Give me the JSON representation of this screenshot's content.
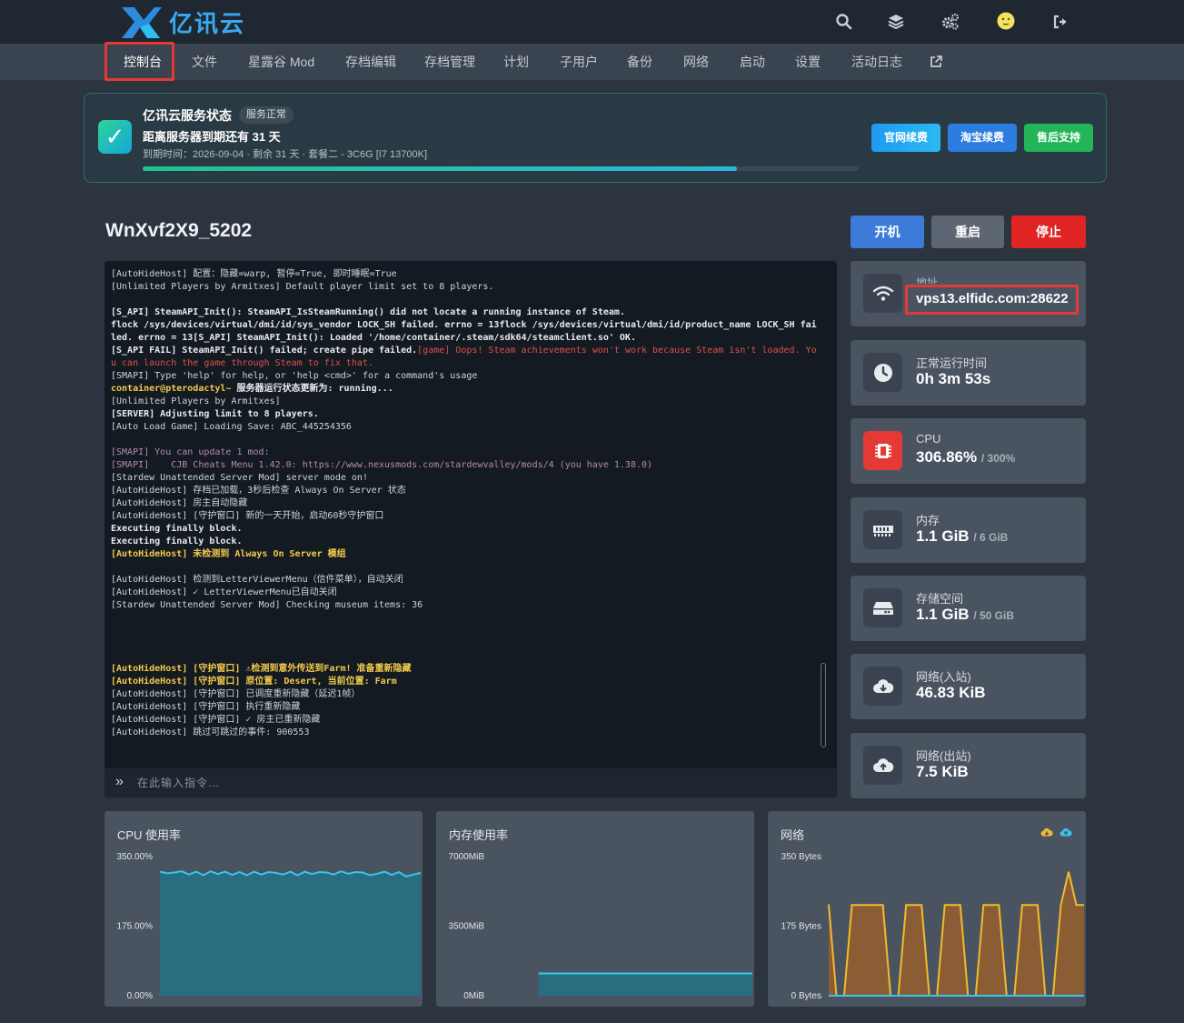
{
  "brand": {
    "name": "亿讯云"
  },
  "colors": {
    "accent": "#4fc3f7",
    "danger": "#e53935",
    "start": "#3d7bd9",
    "restart": "#5d6774",
    "chart_line": "#34c7e8",
    "chart_fill": "#2b6d80",
    "net_in": "#f3b92e",
    "net_fill": "#8a5d34"
  },
  "topbar": {
    "icons": [
      "search-icon",
      "layers-icon",
      "cogs-icon",
      "avatar",
      "logout-icon"
    ]
  },
  "nav": {
    "items": [
      {
        "label": "控制台",
        "active": true
      },
      {
        "label": "文件"
      },
      {
        "label": "星露谷 Mod"
      },
      {
        "label": "存档编辑"
      },
      {
        "label": "存档管理"
      },
      {
        "label": "计划"
      },
      {
        "label": "子用户"
      },
      {
        "label": "备份"
      },
      {
        "label": "网络"
      },
      {
        "label": "启动"
      },
      {
        "label": "设置"
      },
      {
        "label": "活动日志"
      }
    ],
    "external_icon": "external-link-icon"
  },
  "service": {
    "title": "亿讯云服务状态",
    "badge": "服务正常",
    "subtitle": "距离服务器到期还有 31 天",
    "meta": "到期时间：2026-09-04 · 剩余 31 天 · 套餐二 - 3C6G [I7 13700K]",
    "progress": 0.83,
    "buttons": {
      "official": "官网续费",
      "taobao": "淘宝续费",
      "support": "售后支持"
    }
  },
  "server": {
    "name": "WnXvf2X9_5202",
    "start_label": "开机",
    "restart_label": "重启",
    "stop_label": "停止"
  },
  "console": {
    "placeholder": "在此输入指令...",
    "prompt": "»",
    "lines": [
      {
        "text": "[AutoHideHost] 配置：隐藏=warp, 暂停=True, 即时睡眠=True",
        "style": ""
      },
      {
        "text": "[Unlimited Players by Armitxes] Default player limit set to 8 players.",
        "style": ""
      },
      {
        "text": "",
        "style": ""
      },
      {
        "text": "[S_API] SteamAPI_Init(): SteamAPI_IsSteamRunning() did not locate a running instance of Steam.",
        "style": "bold"
      },
      {
        "text": "flock /sys/devices/virtual/dmi/id/sys_vendor LOCK_SH failed. errno = 13flock /sys/devices/virtual/dmi/id/product_name LOCK_SH fai",
        "style": "bold"
      },
      {
        "text": "led. errno = 13[S_API] SteamAPI_Init(): Loaded '/home/container/.steam/sdk64/steamclient.so' OK.",
        "style": "bold"
      },
      {
        "text": "[S_API FAIL] SteamAPI_Init() failed; create pipe failed.",
        "style": "bold",
        "tail": "[game] Oops! Steam achievements won't work because Steam isn't loaded. Yo"
      },
      {
        "text": "u can launch the game through Steam to fix that.",
        "style": "red"
      },
      {
        "text": "[SMAPI] Type 'help' for help, or 'help <cmd>' for a command's usage",
        "style": ""
      },
      {
        "text": "container@pterodactyl~",
        "style": "yellow",
        "tail2": " 服务器运行状态更新为: running..."
      },
      {
        "text": "[Unlimited Players by Armitxes]",
        "style": ""
      },
      {
        "text": "[SERVER] Adjusting limit to 8 players.",
        "style": "bold"
      },
      {
        "text": "[Auto Load Game] Loading Save: ABC_445254356",
        "style": ""
      },
      {
        "text": "",
        "style": ""
      },
      {
        "text": "[SMAPI] You can update 1 mod:",
        "style": "purple"
      },
      {
        "text": "[SMAPI]    CJB Cheats Menu 1.42.0: https://www.nexusmods.com/stardewvalley/mods/4 (you have 1.38.0)",
        "style": "purple"
      },
      {
        "text": "[Stardew Unattended Server Mod] server mode on!",
        "style": ""
      },
      {
        "text": "[AutoHideHost] 存档已加载，3秒后检查 Always On Server 状态",
        "style": ""
      },
      {
        "text": "[AutoHideHost] 房主自动隐藏",
        "style": ""
      },
      {
        "text": "[AutoHideHost] [守护窗口] 新的一天开始，启动60秒守护窗口",
        "style": ""
      },
      {
        "text": "Executing finally block.",
        "style": "bold"
      },
      {
        "text": "Executing finally block.",
        "style": "bold"
      },
      {
        "text": "[AutoHideHost] 未检测到 Always On Server 模组",
        "style": "yellow"
      },
      {
        "text": "",
        "style": ""
      },
      {
        "text": "[AutoHideHost] 检测到LetterViewerMenu（信件菜单），自动关闭",
        "style": ""
      },
      {
        "text": "[AutoHideHost] ✓ LetterViewerMenu已自动关闭",
        "style": ""
      },
      {
        "text": "[Stardew Unattended Server Mod] Checking museum items: 36",
        "style": ""
      },
      {
        "text": "",
        "style": ""
      },
      {
        "text": "",
        "style": ""
      },
      {
        "text": "",
        "style": ""
      },
      {
        "text": "",
        "style": ""
      },
      {
        "text": "[AutoHideHost] [守护窗口] ⚠检测到意外传送到Farm! 准备重新隐藏",
        "style": "yellow"
      },
      {
        "text": "[AutoHideHost] [守护窗口] 原位置: Desert, 当前位置: Farm",
        "style": "yellow"
      },
      {
        "text": "[AutoHideHost] [守护窗口] 已调度重新隐藏（延迟1帧）",
        "style": ""
      },
      {
        "text": "[AutoHideHost] [守护窗口] 执行重新隐藏",
        "style": ""
      },
      {
        "text": "[AutoHideHost] [守护窗口] ✓ 房主已重新隐藏",
        "style": ""
      },
      {
        "text": "[AutoHideHost] 跳过可跳过的事件: 900553",
        "style": ""
      }
    ]
  },
  "stats": {
    "address": {
      "label": "地址",
      "value": "vps13.elfidc.com:28622",
      "icon": "wifi-icon"
    },
    "uptime": {
      "label": "正常运行时间",
      "value": "0h 3m 53s",
      "icon": "clock-icon"
    },
    "cpu": {
      "label": "CPU",
      "value": "306.86%",
      "limit": "/ 300%",
      "icon": "cpu-chip-icon"
    },
    "memory": {
      "label": "内存",
      "value": "1.1 GiB",
      "limit": "/ 6 GiB",
      "icon": "memory-icon"
    },
    "disk": {
      "label": "存储空间",
      "value": "1.1 GiB",
      "limit": "/ 50 GiB",
      "icon": "hdd-icon"
    },
    "net_in": {
      "label": "网络(入站)",
      "value": "46.83 KiB",
      "icon": "cloud-download-icon"
    },
    "net_out": {
      "label": "网络(出站)",
      "value": "7.5 KiB",
      "icon": "cloud-upload-icon"
    }
  },
  "chart_data": [
    {
      "type": "area",
      "title": "CPU 使用率",
      "yticks": [
        "350.00%",
        "175.00%",
        "0.00%"
      ],
      "ylim": [
        0,
        350
      ],
      "values": [
        312,
        308,
        310,
        313,
        305,
        312,
        303,
        313,
        306,
        312,
        304,
        311,
        303,
        312,
        305,
        311,
        309,
        305,
        312,
        303,
        312,
        306,
        311,
        310,
        305,
        313,
        307,
        311,
        310,
        303,
        307,
        312,
        304,
        311,
        300,
        305,
        309
      ]
    },
    {
      "type": "area",
      "title": "内存使用率",
      "yticks": [
        "7000MiB",
        "3500MiB",
        "0MiB"
      ],
      "ylim": [
        0,
        7000
      ],
      "start_fraction": 0.18,
      "values": [
        1120,
        1120,
        1120,
        1120,
        1120,
        1120,
        1120,
        1120
      ]
    },
    {
      "type": "area",
      "title": "网络",
      "yticks": [
        "350 Bytes",
        "175 Bytes",
        "0 Bytes"
      ],
      "ylim": [
        0,
        350
      ],
      "legend_icons": [
        "cloud-download-icon",
        "cloud-upload-icon"
      ],
      "series": [
        {
          "values": [
            230,
            0,
            0,
            228,
            228,
            228,
            228,
            228,
            0,
            0,
            228,
            228,
            228,
            0,
            0,
            228,
            228,
            228,
            0,
            0,
            228,
            228,
            228,
            0,
            0,
            228,
            228,
            228,
            0,
            0,
            228,
            312,
            228,
            228
          ]
        },
        {
          "values": [
            0,
            0,
            0,
            0,
            0,
            0,
            0,
            0,
            0,
            0,
            0,
            0,
            0,
            0,
            0,
            0,
            0,
            0,
            0,
            0,
            0,
            0,
            0,
            0,
            0,
            0,
            0,
            0,
            0,
            0,
            0,
            0,
            0,
            0
          ]
        }
      ]
    }
  ]
}
